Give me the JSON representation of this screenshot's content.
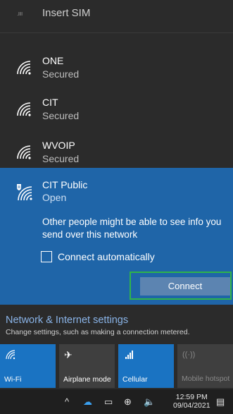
{
  "sim": {
    "label": "Insert SIM"
  },
  "networks": [
    {
      "name": "ONE",
      "status": "Secured"
    },
    {
      "name": "CIT",
      "status": "Secured"
    },
    {
      "name": "WVOIP",
      "status": "Secured"
    }
  ],
  "selected": {
    "name": "CIT Public",
    "status": "Open",
    "warning": "Other people might be able to see info you send over this network",
    "auto_label": "Connect automatically",
    "connect_label": "Connect"
  },
  "settings": {
    "title": "Network & Internet settings",
    "desc": "Change settings, such as making a connection metered."
  },
  "quick": [
    {
      "label": "Wi-Fi",
      "icon": "wifi-icon",
      "state": "on"
    },
    {
      "label": "Airplane mode",
      "icon": "airplane-icon",
      "state": "off"
    },
    {
      "label": "Cellular",
      "icon": "cellular-icon",
      "state": "on"
    },
    {
      "label": "Mobile hotspot",
      "icon": "hotspot-icon",
      "state": "disabled"
    }
  ],
  "taskbar": {
    "time": "12:59 PM",
    "date": "09/04/2021"
  },
  "colors": {
    "accent": "#1f65a8",
    "tile_on": "#1a73c2",
    "highlight": "#2fb44a"
  }
}
